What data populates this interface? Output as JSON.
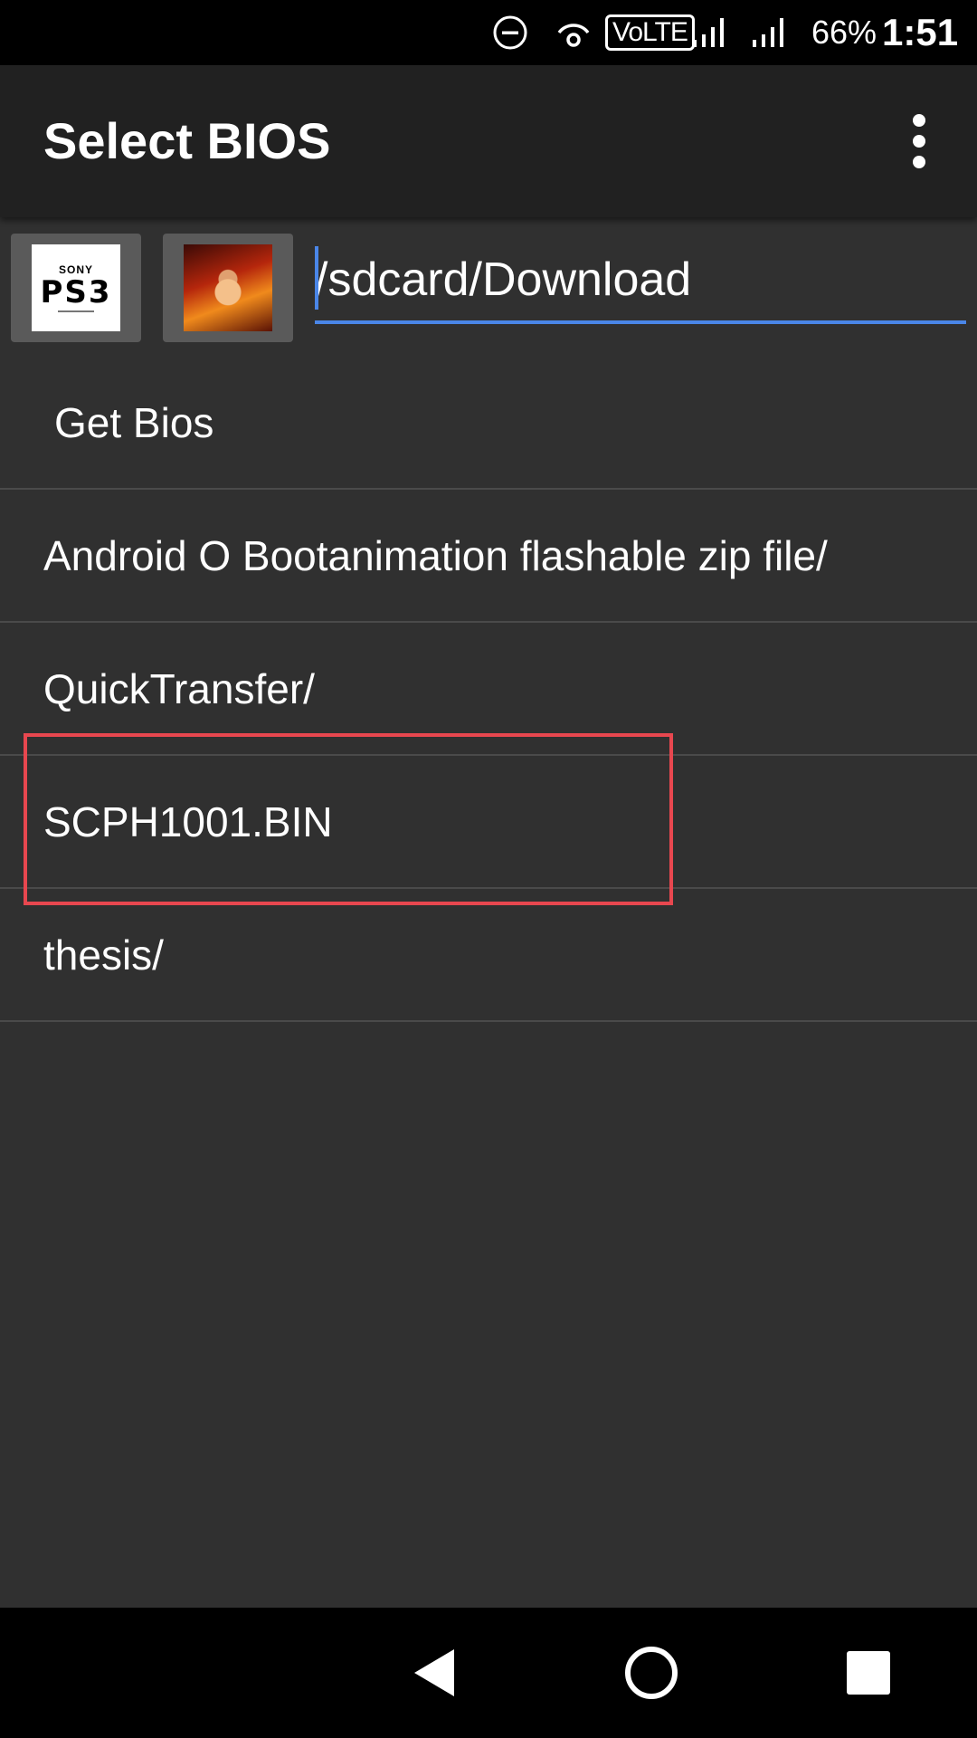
{
  "status_bar": {
    "volte": "VoLTE",
    "battery": "66%",
    "time": "1:51"
  },
  "app_bar": {
    "title": "Select BIOS",
    "menu_icon": "more-vert-icon"
  },
  "path_row": {
    "thumbnails": [
      {
        "name": "PS3",
        "label": "SONY"
      },
      {
        "name": "game-cover"
      }
    ],
    "path_value": "/sdcard/Download"
  },
  "list": {
    "items": [
      {
        "label": "Get Bios"
      },
      {
        "label": "Android O Bootanimation flashable zip file/"
      },
      {
        "label": "QuickTransfer/"
      },
      {
        "label": "SCPH1001.BIN"
      },
      {
        "label": "thesis/"
      }
    ],
    "highlight_color": "#e8474f"
  },
  "nav_bar": {
    "icons": [
      "back-icon",
      "home-icon",
      "recents-icon"
    ]
  },
  "colors": {
    "background": "#303030",
    "app_bar": "#212121",
    "accent": "#4a86e8"
  }
}
